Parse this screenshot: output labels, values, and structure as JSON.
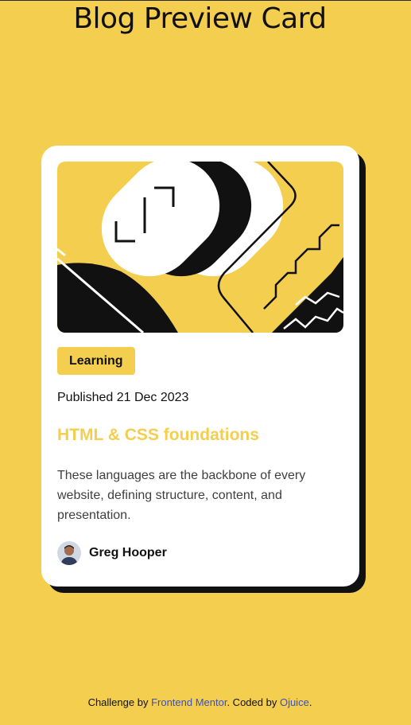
{
  "page": {
    "title": "Blog Preview Card"
  },
  "card": {
    "category": "Learning",
    "published": "Published 21 Dec 2023",
    "title": "HTML & CSS foundations",
    "excerpt": "These languages are the backbone of every website, defining structure, content, and presentation.",
    "author": "Greg Hooper",
    "avatar_icon": "avatar-photo",
    "hero_image": "illustration-article"
  },
  "footer": {
    "prefix": "Challenge by ",
    "challenge_link": "Frontend Mentor",
    "middle": ". Coded by ",
    "author_link": "Ojuice",
    "suffix": "."
  },
  "colors": {
    "background": "#f4ce4f",
    "card": "#ffffff",
    "shadow": "#111111",
    "title_accent": "#f4ce4f",
    "link": "#3b4fbf"
  }
}
